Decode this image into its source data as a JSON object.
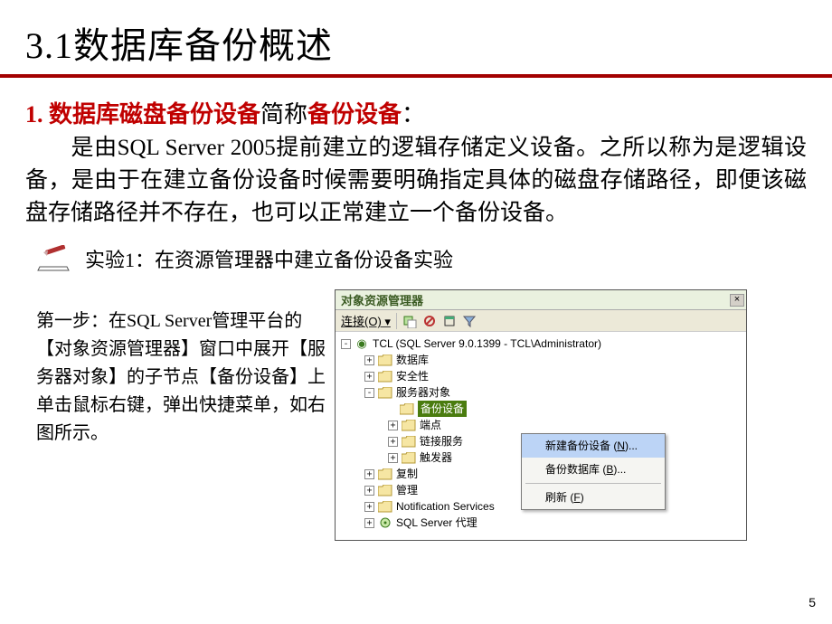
{
  "title": "3.1数据库备份概述",
  "lead": {
    "num": "1. ",
    "red1": "数据库磁盘备份设备",
    "black": "简称",
    "red2": "备份设备",
    "colon": "："
  },
  "paragraph": "是由SQL Server 2005提前建立的逻辑存储定义设备。之所以称为是逻辑设备，是由于在建立备份设备时候需要明确指定具体的磁盘存储路径，即便该磁盘存储路径并不存在，也可以正常建立一个备份设备。",
  "experiment": "实验1：在资源管理器中建立备份设备实验",
  "step_text": "第一步：在SQL Server管理平台的【对象资源管理器】窗口中展开【服务器对象】的子节点【备份设备】上单击鼠标右键，弹出快捷菜单，如右图所示。",
  "panel": {
    "title": "对象资源管理器",
    "close": "×",
    "connect_label": "连接(O) ▾",
    "root": "TCL (SQL Server 9.0.1399 - TCL\\Administrator)",
    "nodes": {
      "db": "数据库",
      "security": "安全性",
      "server_obj": "服务器对象",
      "backup_dev": "备份设备",
      "endpoint": "端点",
      "linked_srv": "链接服务",
      "trigger": "触发器",
      "replication": "复制",
      "manage": "管理",
      "notification": "Notification Services",
      "agent": "SQL Server 代理"
    }
  },
  "ctx_menu": {
    "item1_pre": "新建备份设备 (",
    "item1_u": "N",
    "item1_post": ")...",
    "item2_pre": "备份数据库 (",
    "item2_u": "B",
    "item2_post": ")...",
    "item3_pre": "刷新 (",
    "item3_u": "F",
    "item3_post": ")"
  },
  "pagenum": "5"
}
